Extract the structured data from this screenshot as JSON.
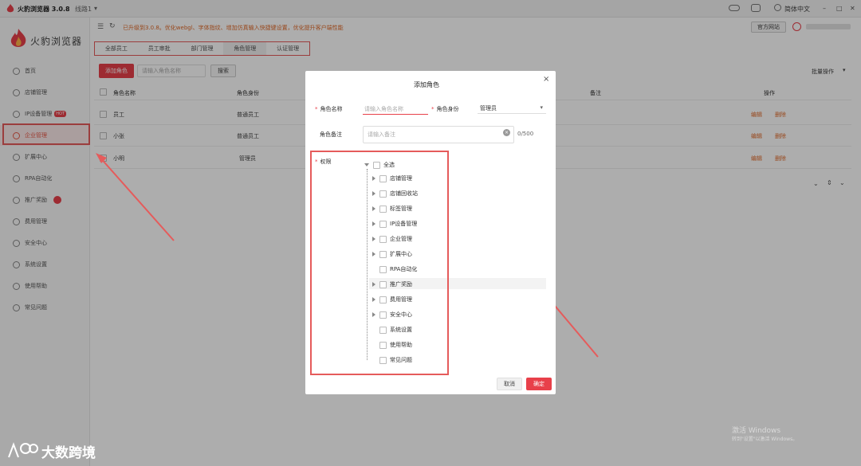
{
  "window": {
    "app_title": "火豹浏览器 3.0.8",
    "env_label": "线路1",
    "language": "简体中文",
    "official_site": "官方网站",
    "min": "–",
    "max": "□",
    "close": "✕"
  },
  "sidebar": {
    "logo_text": "火豹浏览器",
    "hot_badge": "HOT",
    "items": [
      {
        "label": "首页"
      },
      {
        "label": "店铺管理"
      },
      {
        "label": "IP设备管理"
      },
      {
        "label": "企业管理"
      },
      {
        "label": "扩展中心"
      },
      {
        "label": "RPA自动化"
      },
      {
        "label": "推广奖励"
      },
      {
        "label": "费用管理"
      },
      {
        "label": "安全中心"
      },
      {
        "label": "系统设置"
      },
      {
        "label": "使用帮助"
      },
      {
        "label": "常见问题"
      }
    ]
  },
  "toolbar": {
    "notice": "已升级到3.0.8。优化webgl、字体指纹、增加仿真输入快捷键设置，优化提升客户端性能"
  },
  "tabs": [
    {
      "label": "全部员工"
    },
    {
      "label": "员工审批"
    },
    {
      "label": "部门管理"
    },
    {
      "label": "角色管理"
    },
    {
      "label": "认证管理"
    }
  ],
  "actions": {
    "add_role": "添加角色",
    "search_placeholder": "请输入角色名称",
    "search_button": "搜索",
    "batch": "批量操作"
  },
  "table": {
    "headers": [
      "角色名称",
      "角色身份",
      "备注",
      "操作"
    ],
    "rows": [
      {
        "name": "员工",
        "identity": "普通员工",
        "edit": "编辑",
        "delete": "删除"
      },
      {
        "name": "小张",
        "identity": "普通员工",
        "edit": "编辑",
        "delete": "删除"
      },
      {
        "name": "小明",
        "identity": "管理员",
        "edit": "编辑",
        "delete": "删除"
      }
    ]
  },
  "dialog": {
    "title": "添加角色",
    "name_label": "角色名称",
    "name_placeholder": "请输入角色名称",
    "identity_label": "角色身份",
    "identity_value": "管理员",
    "remark_label": "角色备注",
    "remark_placeholder": "请输入备注",
    "remark_count": "0/500",
    "perm_label": "权限",
    "select_all": "全选",
    "perms": [
      {
        "label": "店铺管理",
        "expandable": true
      },
      {
        "label": "店铺回收站",
        "expandable": true
      },
      {
        "label": "标签管理",
        "expandable": true
      },
      {
        "label": "IP设备管理",
        "expandable": true
      },
      {
        "label": "企业管理",
        "expandable": true
      },
      {
        "label": "扩展中心",
        "expandable": true
      },
      {
        "label": "RPA自动化",
        "expandable": false
      },
      {
        "label": "推广奖励",
        "expandable": true
      },
      {
        "label": "费用管理",
        "expandable": true
      },
      {
        "label": "安全中心",
        "expandable": true
      },
      {
        "label": "系统设置",
        "expandable": false
      },
      {
        "label": "使用帮助",
        "expandable": false
      },
      {
        "label": "常见问题",
        "expandable": false
      }
    ],
    "cancel": "取消",
    "confirm": "确定"
  },
  "watermarks": {
    "brand": "大数跨境",
    "windows_line1": "激活 Windows",
    "windows_line2": "转到\"设置\"以激活 Windows。"
  },
  "colors": {
    "accent_red": "#e8404a",
    "highlight_box": "#e55b5b",
    "notice_orange": "#e06a2a"
  }
}
